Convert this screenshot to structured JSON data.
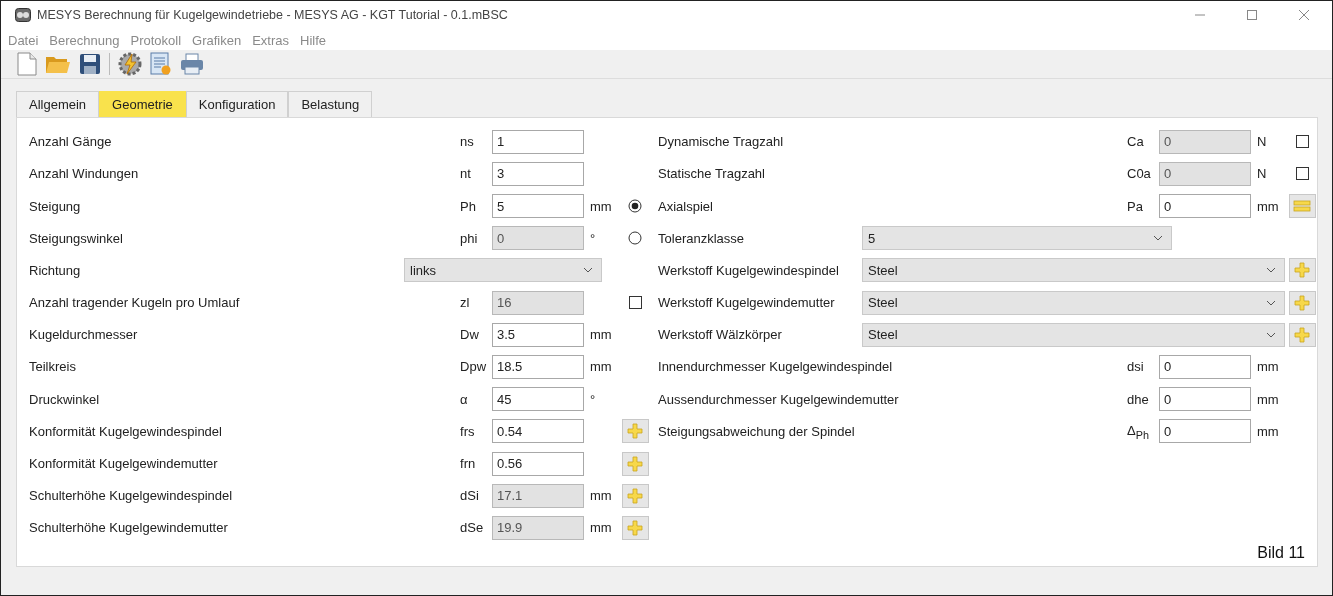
{
  "window": {
    "title": "MESYS Berechnung für Kugelgewindetriebe - MESYS AG - KGT Tutorial - 0.1.mBSC"
  },
  "menu": [
    "Datei",
    "Berechnung",
    "Protokoll",
    "Grafiken",
    "Extras",
    "Hilfe"
  ],
  "tabs": [
    {
      "label": "Allgemein",
      "selected": false
    },
    {
      "label": "Geometrie",
      "selected": true
    },
    {
      "label": "Konfiguration",
      "selected": false
    },
    {
      "label": "Belastung",
      "selected": false
    }
  ],
  "left_rows": [
    {
      "kind": "field",
      "label": "Anzahl Gänge",
      "symbol": "ns",
      "value": "1",
      "disabled": false
    },
    {
      "kind": "field",
      "label": "Anzahl Windungen",
      "symbol": "nt",
      "value": "3",
      "disabled": false
    },
    {
      "kind": "field",
      "label": "Steigung",
      "symbol": "Ph",
      "value": "5",
      "disabled": false,
      "unit": "mm",
      "extra": {
        "kind": "radio",
        "selected": true
      }
    },
    {
      "kind": "field",
      "label": "Steigungswinkel",
      "symbol": "phi",
      "value": "0",
      "disabled": true,
      "unit": "°",
      "extra": {
        "kind": "radio",
        "selected": false
      }
    },
    {
      "kind": "select",
      "label": "Richtung",
      "value": "links"
    },
    {
      "kind": "field",
      "label": "Anzahl tragender Kugeln pro Umlauf",
      "symbol": "zl",
      "value": "16",
      "disabled": true,
      "extra": {
        "kind": "checkbox",
        "checked": false
      }
    },
    {
      "kind": "field",
      "label": "Kugeldurchmesser",
      "symbol": "Dw",
      "value": "3.5",
      "disabled": false,
      "unit": "mm"
    },
    {
      "kind": "field",
      "label": "Teilkreis",
      "symbol": "Dpw",
      "value": "18.5",
      "disabled": false,
      "unit": "mm"
    },
    {
      "kind": "field",
      "label": "Druckwinkel",
      "symbol": "α",
      "value": "45",
      "disabled": false,
      "unit": "°"
    },
    {
      "kind": "field",
      "label": "Konformität Kugelgewindespindel",
      "symbol": "frs",
      "value": "0.54",
      "disabled": false,
      "extra": {
        "kind": "plus"
      }
    },
    {
      "kind": "field",
      "label": "Konformität Kugelgewindemutter",
      "symbol": "frn",
      "value": "0.56",
      "disabled": false,
      "extra": {
        "kind": "plus"
      }
    },
    {
      "kind": "field",
      "label": "Schulterhöhe Kugelgewindespindel",
      "symbol": "dSi",
      "value": "17.1",
      "disabled": true,
      "unit": "mm",
      "extra": {
        "kind": "plus"
      }
    },
    {
      "kind": "field",
      "label": "Schulterhöhe Kugelgewindemutter",
      "symbol": "dSe",
      "value": "19.9",
      "disabled": true,
      "unit": "mm",
      "extra": {
        "kind": "plus"
      }
    }
  ],
  "right_rows": [
    {
      "kind": "field",
      "label": "Dynamische Tragzahl",
      "symbol": "Ca",
      "value": "0",
      "disabled": true,
      "unit": "N",
      "extra": {
        "kind": "checkbox",
        "checked": false
      }
    },
    {
      "kind": "field",
      "label": "Statische Tragzahl",
      "symbol": "C0a",
      "value": "0",
      "disabled": true,
      "unit": "N",
      "extra": {
        "kind": "checkbox",
        "checked": false
      }
    },
    {
      "kind": "field",
      "label": "Axialspiel",
      "symbol": "Pa",
      "value": "0",
      "disabled": false,
      "unit": "mm",
      "extra": {
        "kind": "list"
      }
    },
    {
      "kind": "select",
      "label": "Toleranzklasse",
      "value": "5"
    },
    {
      "kind": "select",
      "label": "Werkstoff Kugelgewindespindel",
      "value": "Steel",
      "extra": {
        "kind": "plus"
      }
    },
    {
      "kind": "select",
      "label": "Werkstoff Kugelgewindemutter",
      "value": "Steel",
      "extra": {
        "kind": "plus"
      }
    },
    {
      "kind": "select",
      "label": "Werkstoff Wälzkörper",
      "value": "Steel",
      "extra": {
        "kind": "plus"
      }
    },
    {
      "kind": "field",
      "label": "Innendurchmesser Kugelgewindespindel",
      "symbol": "dsi",
      "value": "0",
      "disabled": false,
      "unit": "mm"
    },
    {
      "kind": "field",
      "label": "Aussendurchmesser Kugelgewindemutter",
      "symbol": "dhe",
      "value": "0",
      "disabled": false,
      "unit": "mm"
    },
    {
      "kind": "field",
      "label": "Steigungsabweichung der Spindel",
      "symbol": "Δ$_{Ph}$",
      "value": "0",
      "disabled": false,
      "unit": "mm"
    }
  ],
  "figure_label": "Bild 11"
}
